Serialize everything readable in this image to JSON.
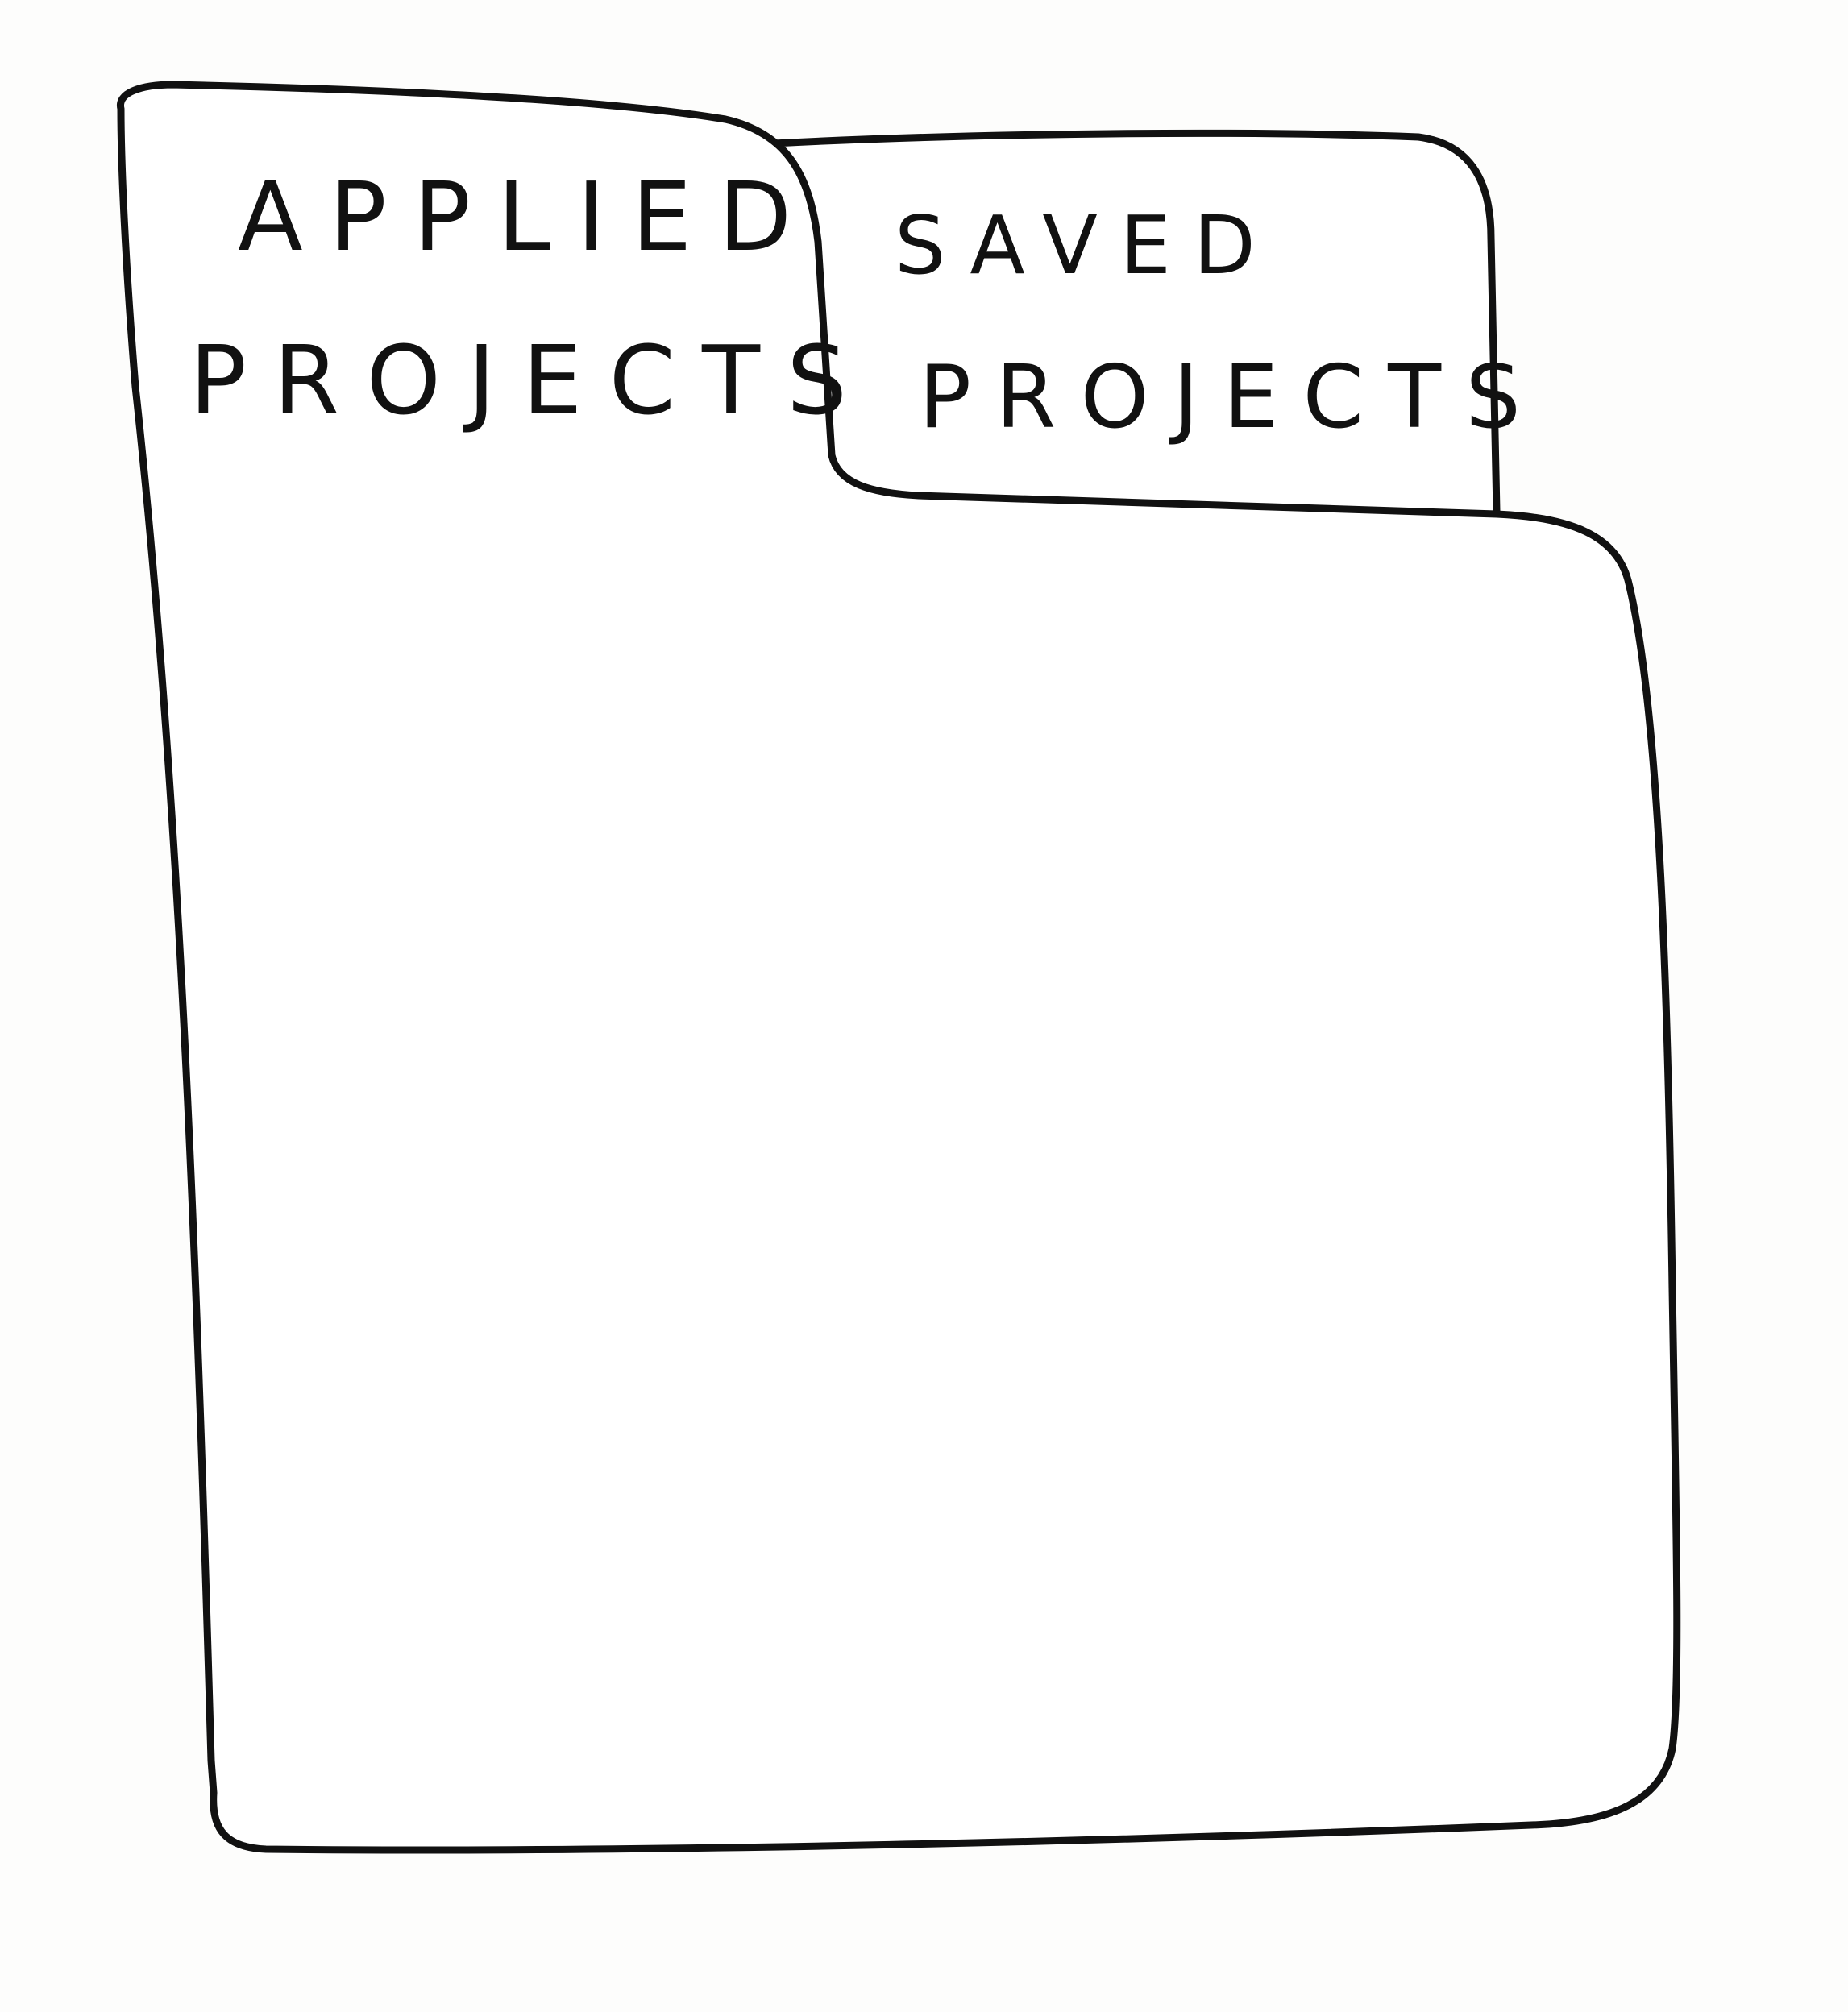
{
  "tabs": [
    {
      "id": "applied",
      "lines": [
        "APPLIED",
        "PROJECTS"
      ],
      "active": true
    },
    {
      "id": "saved",
      "lines": [
        "SAVED",
        "PROJECTS"
      ],
      "active": false
    }
  ],
  "colors": {
    "ink": "#111111",
    "paper": "#fdfdfc"
  }
}
